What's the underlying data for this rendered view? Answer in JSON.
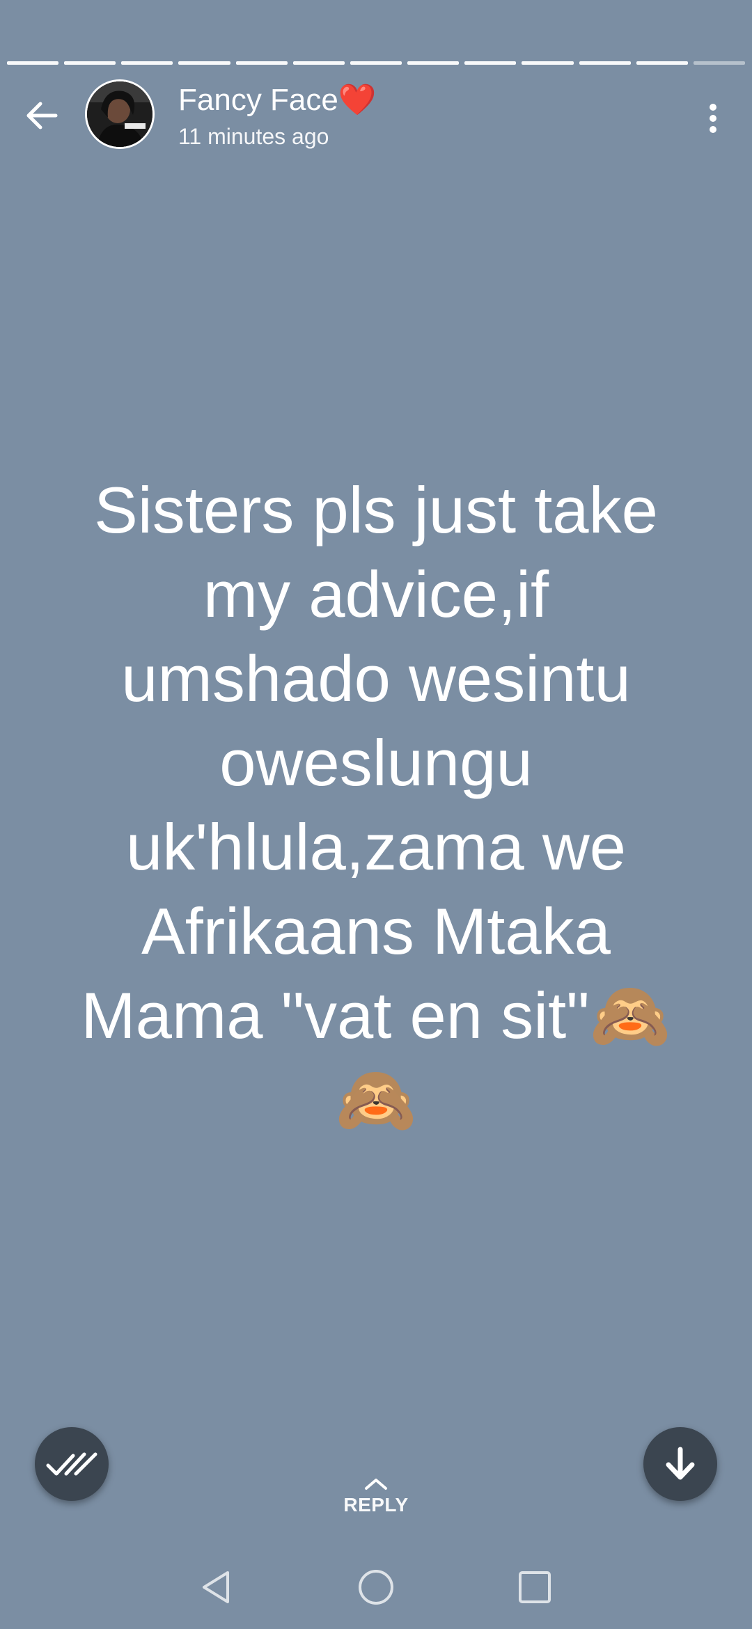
{
  "status": {
    "user_name": "Fancy Face",
    "name_emoji": "❤️",
    "time_ago": "11 minutes ago",
    "text": "Sisters pls just take\nmy advice,if\numshado wesintu\noweslungu\nuk'hlula,zama we\nAfrikaans Mtaka\nMama \"vat en sit\"🙈\n🙈",
    "background_color": "#7b8ea3",
    "segments_total": 13,
    "segments_viewed": 12
  },
  "header": {
    "back_icon": "arrow-left-icon",
    "menu_icon": "more-vertical-icon"
  },
  "bottom": {
    "reply_label": "REPLY",
    "seen_icon": "double-check-icon",
    "download_icon": "arrow-down-icon"
  },
  "navbar": {
    "back_icon": "triangle-back-icon",
    "home_icon": "circle-home-icon",
    "recents_icon": "square-recents-icon"
  }
}
